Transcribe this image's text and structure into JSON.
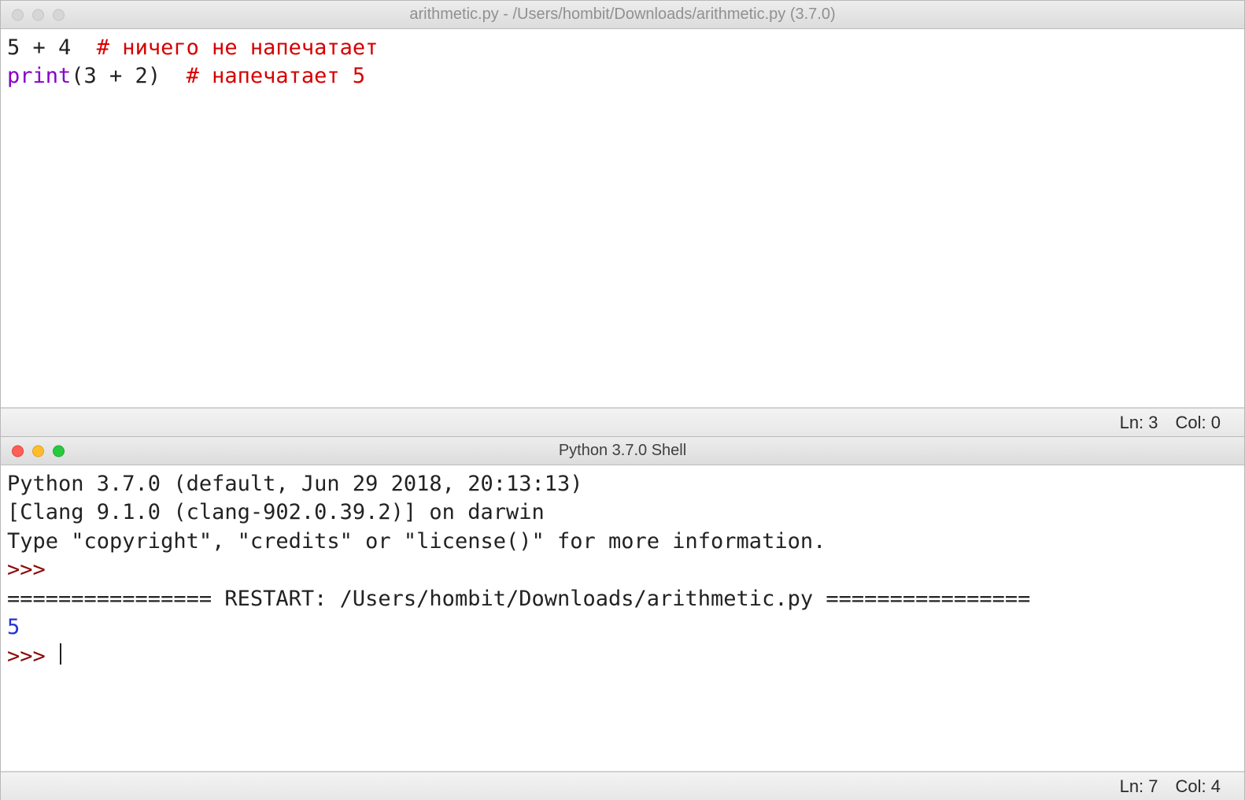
{
  "editor_window": {
    "title": "arithmetic.py - /Users/hombit/Downloads/arithmetic.py (3.7.0)",
    "traffic_active": false,
    "code": {
      "line1_expr": "5 + 4  ",
      "line1_comment": "# ничего не напечатает",
      "line2_builtin": "print",
      "line2_args": "(3 + 2)  ",
      "line2_comment": "# напечатает 5"
    },
    "status": {
      "ln_label": "Ln: 3",
      "col_label": "Col: 0"
    }
  },
  "shell_window": {
    "title": "Python 3.7.0 Shell",
    "traffic_active": true,
    "banner_line1": "Python 3.7.0 (default, Jun 29 2018, 20:13:13) ",
    "banner_line2": "[Clang 9.1.0 (clang-902.0.39.2)] on darwin",
    "banner_line3": "Type \"copyright\", \"credits\" or \"license()\" for more information.",
    "prompt": ">>> ",
    "restart_line": "================ RESTART: /Users/hombit/Downloads/arithmetic.py ================",
    "output_value": "5",
    "status": {
      "ln_label": "Ln: 7",
      "col_label": "Col: 4"
    }
  }
}
